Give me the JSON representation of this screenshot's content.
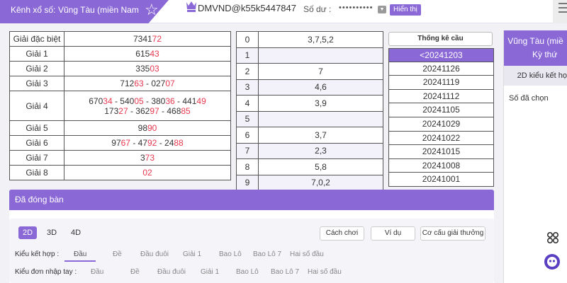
{
  "header": {
    "lottery_label": "Kênh xổ số:",
    "lottery_value": "Vũng Tàu (miền Nam",
    "account": "DMVND@k55k5447847",
    "balance_label": "Số dư :",
    "balance_value": "••••••••••",
    "show_button": "Hiển thị"
  },
  "results": [
    {
      "label": "Giải đặc biệt",
      "lines": [
        [
          {
            "t": "7341",
            "r": false
          },
          {
            "t": "72",
            "r": true
          }
        ]
      ]
    },
    {
      "label": "Giải 1",
      "lines": [
        [
          {
            "t": "615",
            "r": false
          },
          {
            "t": "43",
            "r": true
          }
        ]
      ]
    },
    {
      "label": "Giải 2",
      "lines": [
        [
          {
            "t": "335",
            "r": false
          },
          {
            "t": "03",
            "r": true
          }
        ]
      ]
    },
    {
      "label": "Giải 3",
      "lines": [
        [
          {
            "t": "712",
            "r": false
          },
          {
            "t": "63",
            "r": true
          },
          {
            "t": " - 027",
            "r": false
          },
          {
            "t": "07",
            "r": true
          }
        ]
      ]
    },
    {
      "label": "Giải 4",
      "lines": [
        [
          {
            "t": "670",
            "r": false
          },
          {
            "t": "34",
            "r": true
          },
          {
            "t": " - 540",
            "r": false
          },
          {
            "t": "05",
            "r": true
          },
          {
            "t": " - 380",
            "r": false
          },
          {
            "t": "36",
            "r": true
          },
          {
            "t": " - 441",
            "r": false
          },
          {
            "t": "49",
            "r": true
          }
        ],
        [
          {
            "t": "173",
            "r": false
          },
          {
            "t": "27",
            "r": true
          },
          {
            "t": " - 362",
            "r": false
          },
          {
            "t": "97",
            "r": true
          },
          {
            "t": " - 468",
            "r": false
          },
          {
            "t": "85",
            "r": true
          }
        ]
      ]
    },
    {
      "label": "Giải 5",
      "lines": [
        [
          {
            "t": "98",
            "r": false
          },
          {
            "t": "90",
            "r": true
          }
        ]
      ]
    },
    {
      "label": "Giải 6",
      "lines": [
        [
          {
            "t": "97",
            "r": false
          },
          {
            "t": "67",
            "r": true
          },
          {
            "t": " - 47",
            "r": false
          },
          {
            "t": "92",
            "r": true
          },
          {
            "t": " - 24",
            "r": false
          },
          {
            "t": "88",
            "r": true
          }
        ]
      ]
    },
    {
      "label": "Giải 7",
      "lines": [
        [
          {
            "t": "3",
            "r": false
          },
          {
            "t": "73",
            "r": true
          }
        ]
      ]
    },
    {
      "label": "Giải 8",
      "lines": [
        [
          {
            "t": "02",
            "r": true
          }
        ]
      ]
    }
  ],
  "loto": [
    {
      "head": "0",
      "tails": "3,7,5,2"
    },
    {
      "head": "1",
      "tails": ""
    },
    {
      "head": "2",
      "tails": "7"
    },
    {
      "head": "3",
      "tails": "4,6"
    },
    {
      "head": "4",
      "tails": "3,9"
    },
    {
      "head": "5",
      "tails": ""
    },
    {
      "head": "6",
      "tails": "3,7"
    },
    {
      "head": "7",
      "tails": "2,3"
    },
    {
      "head": "8",
      "tails": "5,8"
    },
    {
      "head": "9",
      "tails": "7,0,2"
    }
  ],
  "stats": {
    "title": "Thống kê cầu",
    "dates": [
      "<20241203",
      "20241126",
      "20241119",
      "20241112",
      "20241105",
      "20241029",
      "20241022",
      "20241015",
      "20241008",
      "20241001"
    ],
    "active_index": 0
  },
  "right_panel": {
    "title_line1": "Vũng Tàu (miề",
    "title_line2": "Kỳ thứ",
    "sub_label": "2D kiểu kết họ",
    "selected_label": "Số đã chọn"
  },
  "closed_label": "Đã đóng bàn",
  "bet": {
    "modes": [
      "2D",
      "3D",
      "4D"
    ],
    "active_mode": 0,
    "actions": [
      "Cách chơi",
      "Ví dụ",
      "Cơ cấu giải thưởng"
    ],
    "combo_label": "Kiểu kết hợp :",
    "combo_options": [
      "Đầu",
      "Đề",
      "Đầu đuôi",
      "Giải 1",
      "Bao Lô",
      "Bao Lô 7",
      "Hai số đầu"
    ],
    "manual_label": "Kiểu đơn nhập tay :",
    "manual_options": [
      "Đầu",
      "Đề",
      "Đầu đuôi",
      "Giải 1",
      "Bao Lô",
      "Bao Lô 7",
      "Hai số đầu"
    ]
  },
  "colors": {
    "accent": "#8a68d6",
    "highlight_digit": "#e8384f"
  }
}
